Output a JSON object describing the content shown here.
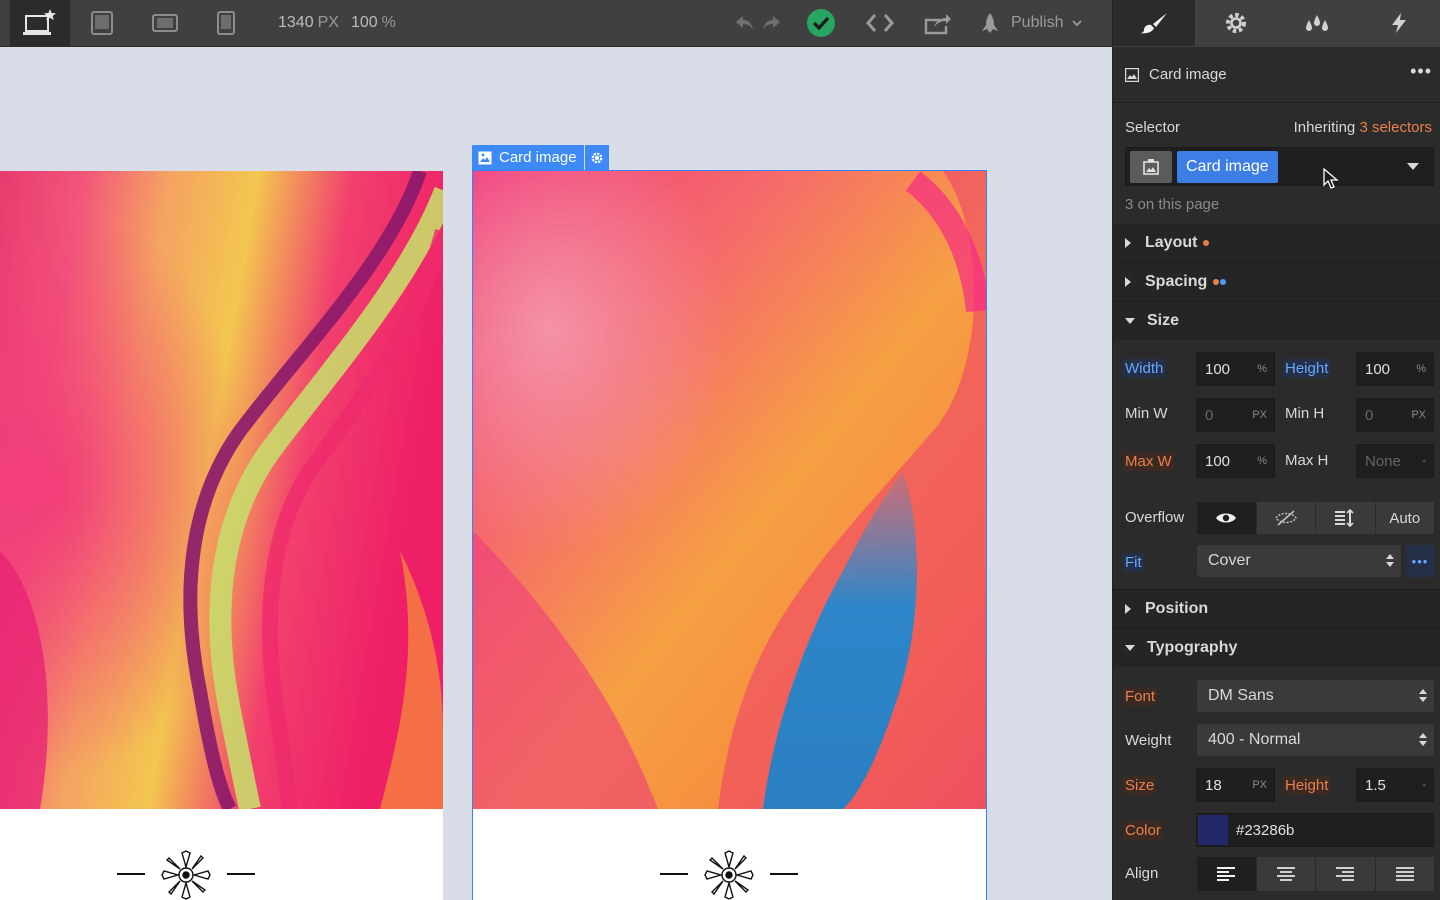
{
  "toolbar": {
    "zoom_width": "1340",
    "zoom_width_unit": "PX",
    "zoom_percent": "100",
    "zoom_percent_unit": "%",
    "publish_label": "Publish"
  },
  "canvas": {
    "selected_label": "Card image"
  },
  "panel": {
    "header_title": "Card image",
    "more_label": "•••",
    "selector_label": "Selector",
    "inheriting_prefix": "Inheriting",
    "inheriting_link": "3 selectors",
    "selector_chip": "Card image",
    "on_page": "3 on this page",
    "sections": {
      "layout": "Layout",
      "spacing": "Spacing",
      "size": "Size",
      "position": "Position",
      "typography": "Typography"
    },
    "size": {
      "width_label": "Width",
      "width_value": "100",
      "width_unit": "%",
      "height_label": "Height",
      "height_value": "100",
      "height_unit": "%",
      "minw_label": "Min W",
      "minw_value": "0",
      "minw_unit": "PX",
      "minh_label": "Min H",
      "minh_value": "0",
      "minh_unit": "PX",
      "maxw_label": "Max W",
      "maxw_value": "100",
      "maxw_unit": "%",
      "maxh_label": "Max H",
      "maxh_value": "None",
      "maxh_unit": "-",
      "overflow_label": "Overflow",
      "overflow_auto": "Auto",
      "fit_label": "Fit",
      "fit_value": "Cover",
      "fit_more": "•••"
    },
    "typography": {
      "font_label": "Font",
      "font_value": "DM Sans",
      "weight_label": "Weight",
      "weight_value": "400 - Normal",
      "size_label": "Size",
      "size_value": "18",
      "size_unit": "PX",
      "lh_label": "Height",
      "lh_value": "1.5",
      "lh_unit": "-",
      "color_label": "Color",
      "color_value": "#23286b",
      "align_label": "Align"
    }
  },
  "colors": {
    "accent": "#3d7ee6",
    "orange_indicator": "#e8804c",
    "blue_indicator": "#4a9bff",
    "success": "#27a563",
    "swatch": "#23286b"
  }
}
